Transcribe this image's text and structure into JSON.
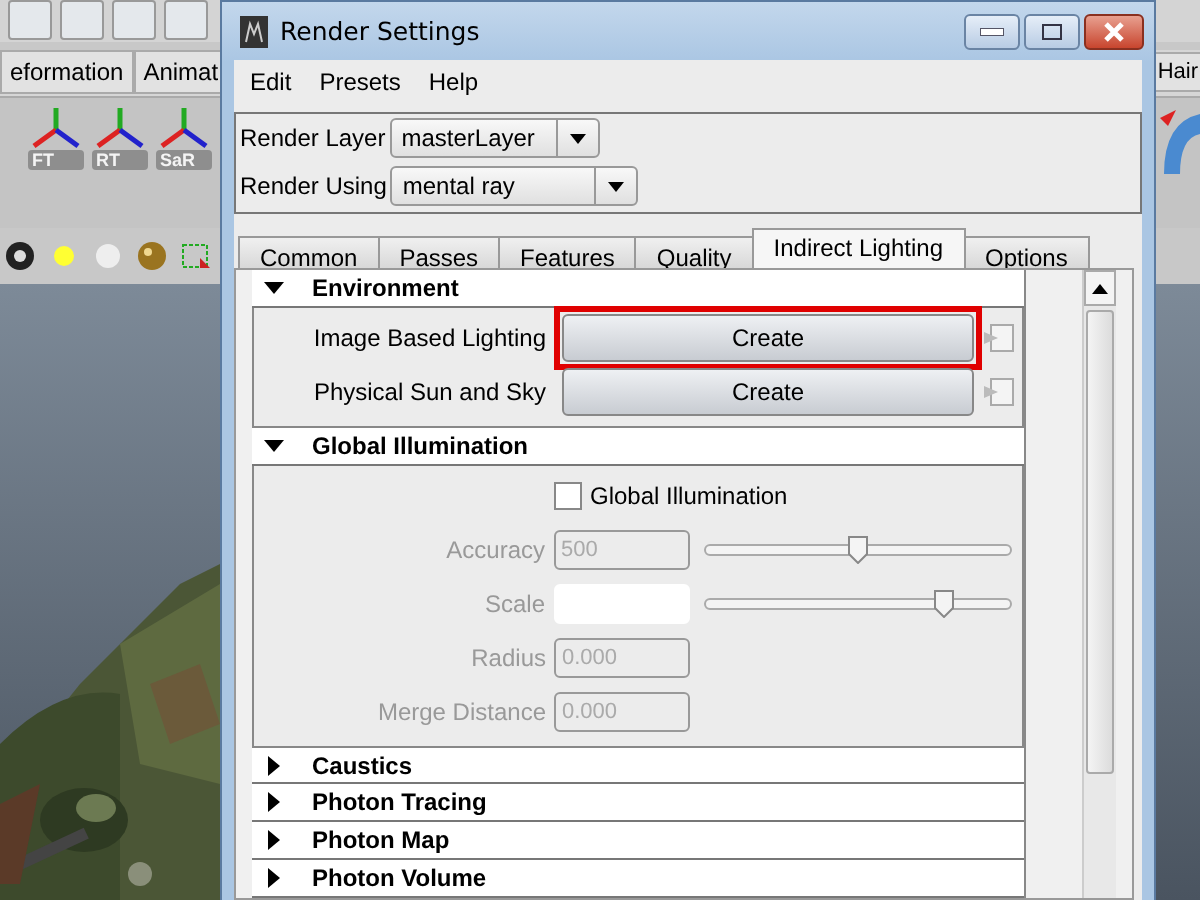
{
  "app": {
    "shelf_tabs": [
      {
        "label": "eformation"
      },
      {
        "label": "Animat"
      }
    ],
    "right_tab": "Hair",
    "shelf_icons": [
      {
        "label": "FT"
      },
      {
        "label": "RT"
      },
      {
        "label": "SaR"
      }
    ]
  },
  "window": {
    "title": "Render Settings",
    "menu": [
      "Edit",
      "Presets",
      "Help"
    ],
    "selectors": [
      {
        "label": "Render Layer",
        "value": "masterLayer"
      },
      {
        "label": "Render Using",
        "value": "mental ray"
      }
    ],
    "tabs": [
      {
        "label": "Common",
        "selected": false
      },
      {
        "label": "Passes",
        "selected": false
      },
      {
        "label": "Features",
        "selected": false
      },
      {
        "label": "Quality",
        "selected": false
      },
      {
        "label": "Indirect Lighting",
        "selected": true
      },
      {
        "label": "Options",
        "selected": false
      }
    ],
    "sections": [
      {
        "title": "Environment",
        "expanded": true,
        "rows": [
          {
            "kind": "button",
            "label": "Image Based Lighting",
            "button": "Create",
            "highlighted": true
          },
          {
            "kind": "button",
            "label": "Physical Sun and Sky",
            "button": "Create",
            "highlighted": false
          }
        ]
      },
      {
        "title": "Global Illumination",
        "expanded": true,
        "rows": [
          {
            "kind": "checkbox",
            "label": "Global Illumination",
            "checked": false
          },
          {
            "kind": "slider",
            "label": "Accuracy",
            "value": "500",
            "level": 0.5,
            "disabled": true
          },
          {
            "kind": "slider",
            "label": "Scale",
            "level": 0.78,
            "disabled": true
          },
          {
            "kind": "field",
            "label": "Radius",
            "value": "0.000",
            "disabled": true
          },
          {
            "kind": "field",
            "label": "Merge Distance",
            "value": "0.000",
            "disabled": true
          }
        ]
      },
      {
        "title": "Caustics",
        "expanded": false
      },
      {
        "title": "Photon Tracing",
        "expanded": false
      },
      {
        "title": "Photon Map",
        "expanded": false
      },
      {
        "title": "Photon Volume",
        "expanded": false
      }
    ]
  }
}
